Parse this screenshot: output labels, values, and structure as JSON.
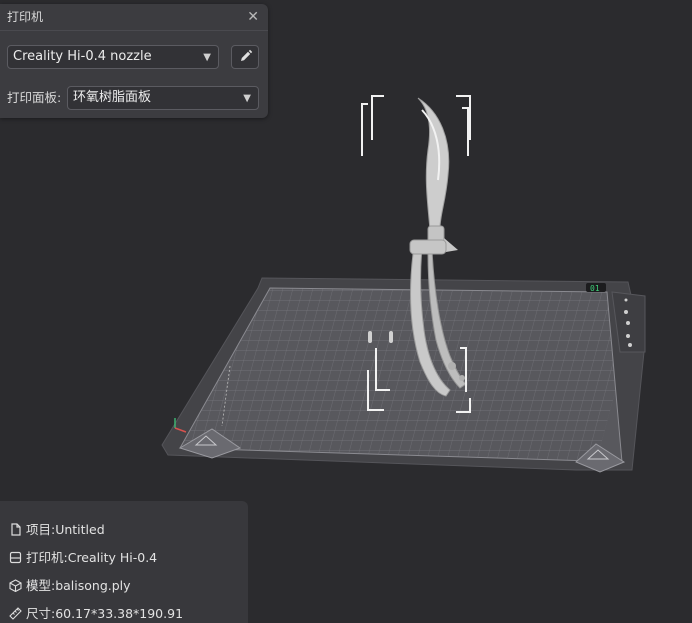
{
  "printer_panel": {
    "title": "打印机",
    "printer_name": "Creality Hi-0.4 nozzle",
    "plate_label": "打印面板:",
    "plate_value": "环氧树脂面板"
  },
  "bed": {
    "corner_badge": "01"
  },
  "info": {
    "project": "项目:Untitled",
    "printer": "打印机:Creality Hi-0.4",
    "model": "模型:balisong.ply",
    "size": "尺寸:60.17*33.38*190.91"
  }
}
